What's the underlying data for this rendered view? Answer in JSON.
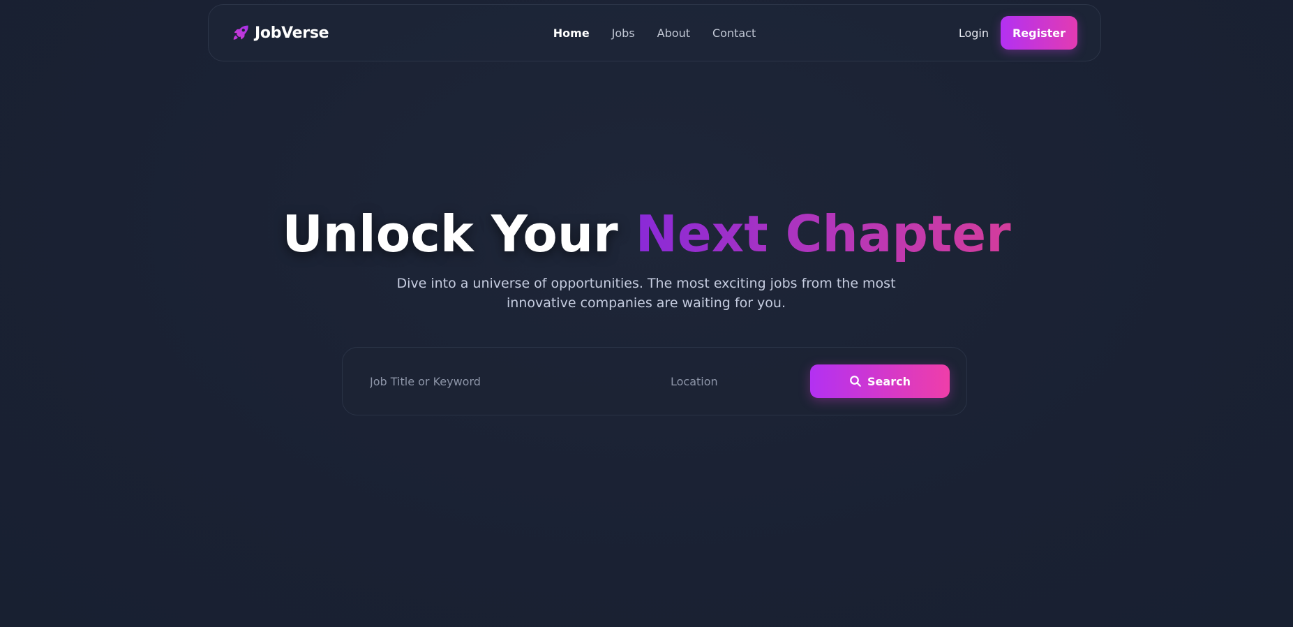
{
  "brand": {
    "name": "JobVerse",
    "icon": "rocket-icon",
    "accent_color": "#c03be6"
  },
  "nav": {
    "links": [
      {
        "label": "Home",
        "active": true
      },
      {
        "label": "Jobs",
        "active": false
      },
      {
        "label": "About",
        "active": false
      },
      {
        "label": "Contact",
        "active": false
      }
    ],
    "login_label": "Login",
    "register_label": "Register"
  },
  "hero": {
    "title_plain": "Unlock Your ",
    "title_accent": "Next Chapter",
    "subtitle": "Dive into a universe of opportunities. The most exciting jobs from the most innovative companies are waiting for you."
  },
  "search": {
    "keyword_placeholder": "Job Title or Keyword",
    "keyword_value": "",
    "location_placeholder": "Location",
    "location_value": "",
    "button_label": "Search",
    "button_icon": "search-icon"
  },
  "colors": {
    "background": "#1b2335",
    "gradient_start": "#b331f2",
    "gradient_end": "#ef3ea9"
  }
}
